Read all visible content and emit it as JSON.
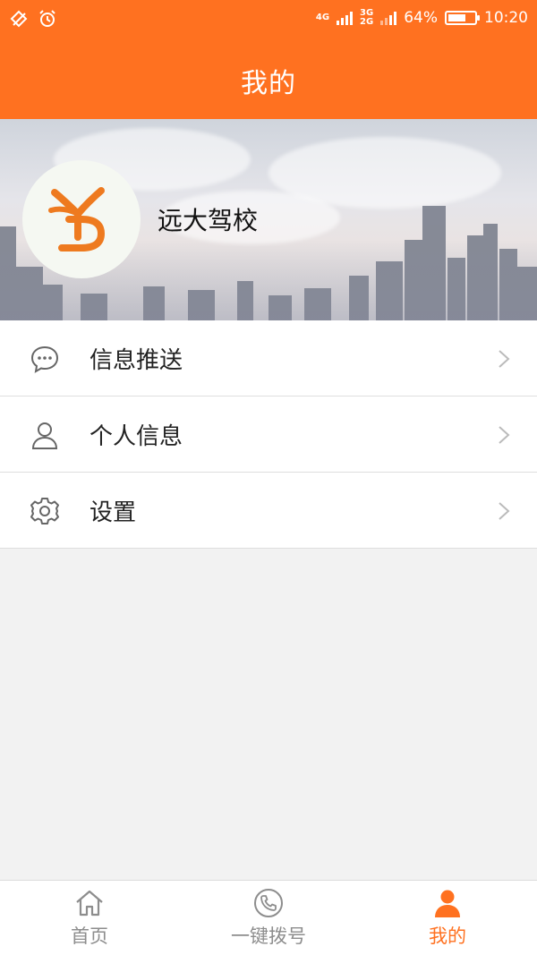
{
  "status_bar": {
    "battery_text": "64%",
    "battery_level": 0.64,
    "time": "10:20",
    "network_1": "4G",
    "network_2_top": "3G",
    "network_2_bottom": "2G"
  },
  "header": {
    "title": "我的",
    "color": "#ff7120"
  },
  "profile": {
    "name": "远大驾校",
    "logo_icon": "yd-driving-school-logo"
  },
  "menu": {
    "items": [
      {
        "label": "信息推送",
        "icon": "chat-bubble-icon"
      },
      {
        "label": "个人信息",
        "icon": "user-icon"
      },
      {
        "label": "设置",
        "icon": "gear-icon"
      }
    ]
  },
  "tabbar": {
    "items": [
      {
        "label": "首页",
        "icon": "home-icon",
        "active": false
      },
      {
        "label": "一键拨号",
        "icon": "phone-icon",
        "active": false
      },
      {
        "label": "我的",
        "icon": "person-icon",
        "active": true
      }
    ],
    "active_color": "#ff7120",
    "inactive_color": "#8d8d8d"
  }
}
